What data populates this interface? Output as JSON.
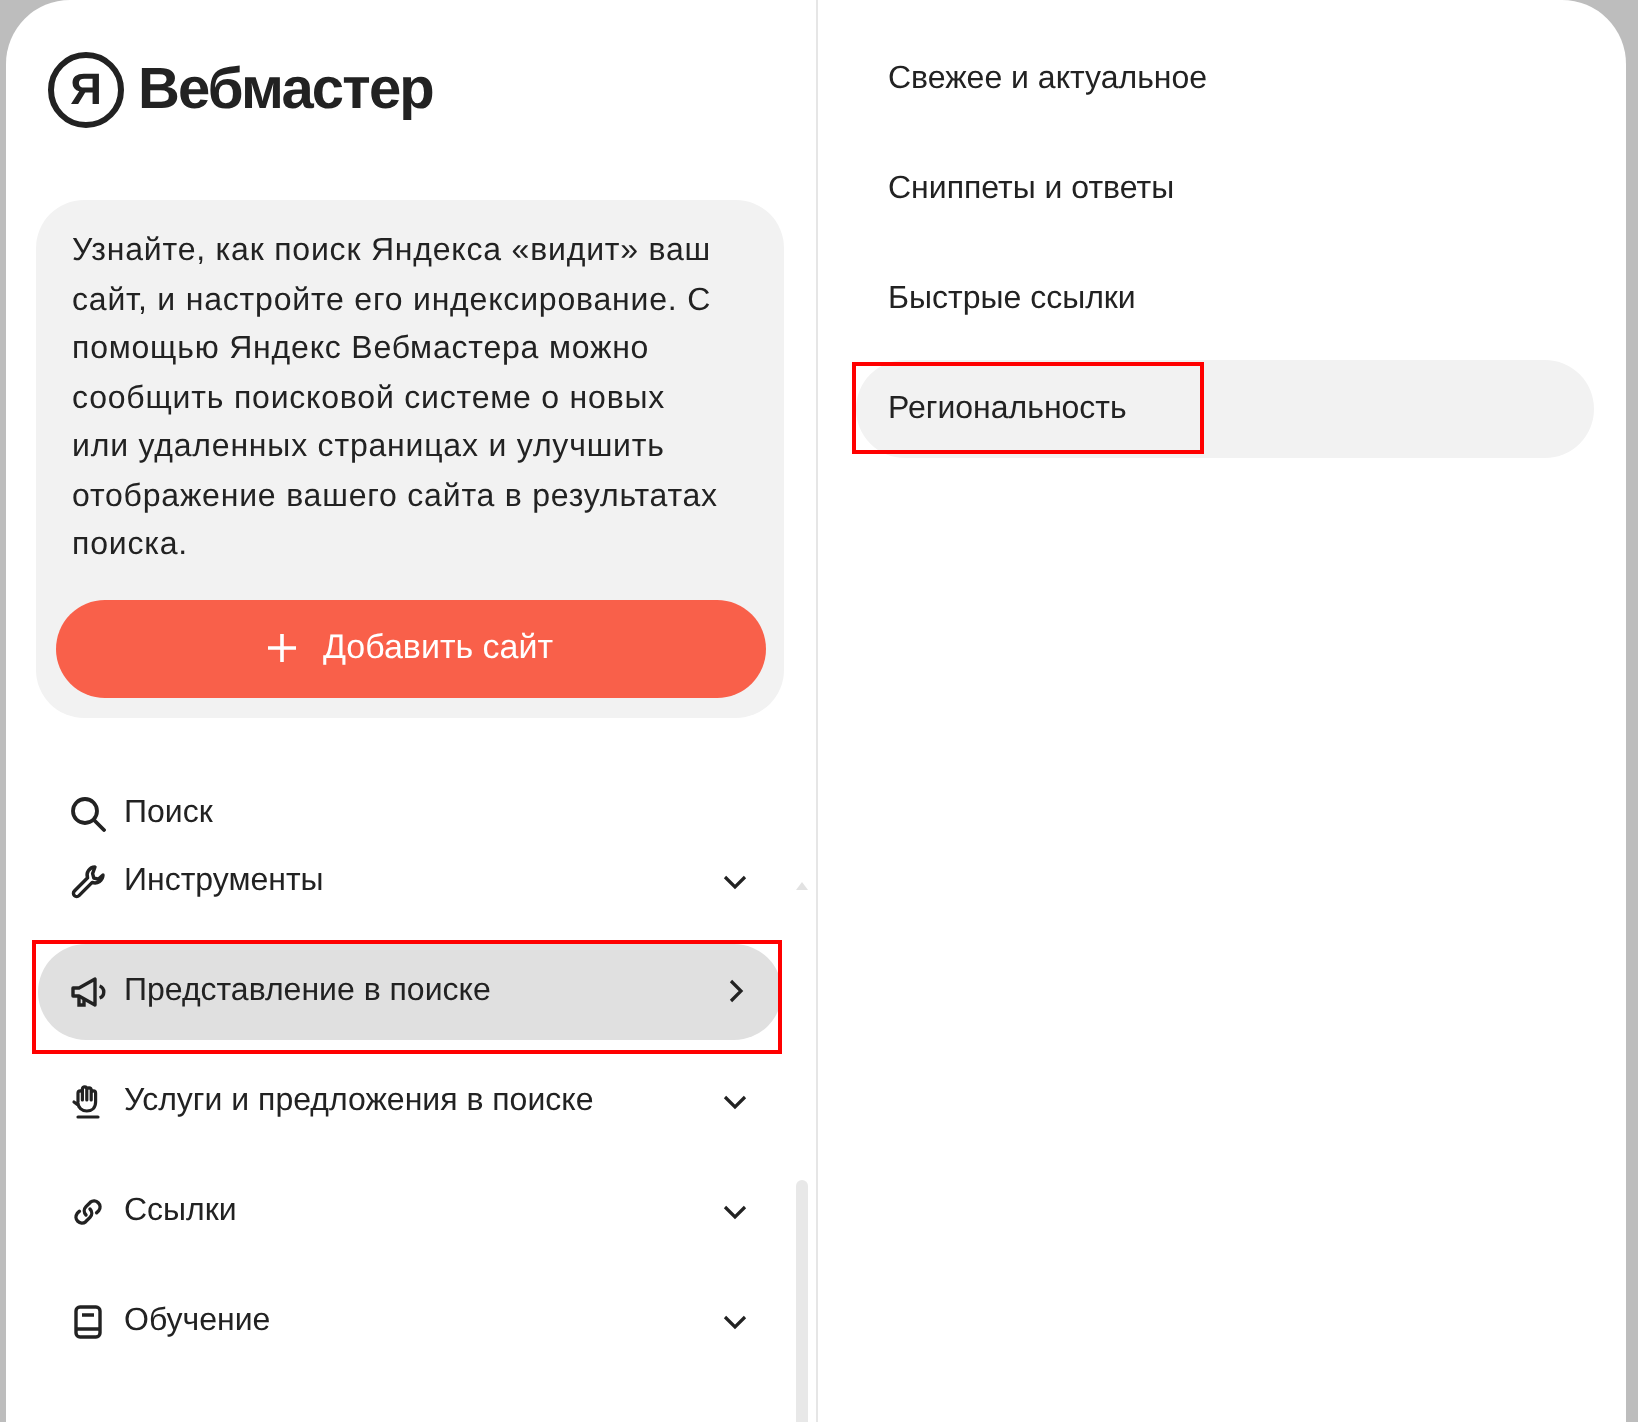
{
  "logo": {
    "mark": "Я",
    "text": "Вебмастер"
  },
  "promo": {
    "text": "Узнайте, как поиск Яндекса «видит» ваш\nсайт, и настройте его индексирование. С\nпомощью Яндекс Вебмастера можно\nсообщить поисковой системе о новых\nили удаленных страницах и улучшить\nотображение вашего сайта в результатах\nпоиска.",
    "button": {
      "label": "Добавить сайт"
    }
  },
  "search": {
    "label": "Поиск"
  },
  "nav": [
    {
      "label": "Инструменты",
      "selected": false,
      "annotated": false
    },
    {
      "label": "Представление в поиске",
      "selected": true,
      "annotated": true
    },
    {
      "label": "Услуги и предложения в поиске",
      "selected": false,
      "annotated": false
    },
    {
      "label": "Ссылки",
      "selected": false,
      "annotated": false
    },
    {
      "label": "Обучение",
      "selected": false,
      "annotated": false
    }
  ],
  "submenu": [
    {
      "label": "Свежее и актуальное",
      "selected": false,
      "annotated": false
    },
    {
      "label": "Сниппеты и ответы",
      "selected": false,
      "annotated": false
    },
    {
      "label": "Быстрые ссылки",
      "selected": false,
      "annotated": false
    },
    {
      "label": "Региональность",
      "selected": true,
      "annotated": true
    }
  ]
}
